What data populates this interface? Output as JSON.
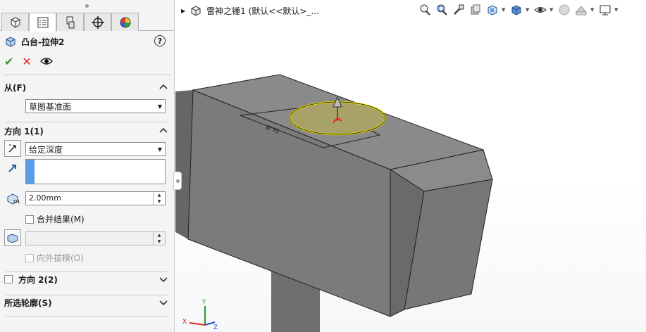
{
  "property_manager": {
    "tabs": [
      {
        "name": "feature-manager"
      },
      {
        "name": "property-manager"
      },
      {
        "name": "configuration-manager"
      },
      {
        "name": "dimxpert-manager"
      },
      {
        "name": "display-manager"
      }
    ],
    "feature_title": "凸台-拉伸2",
    "help_label": "?",
    "from_section": {
      "title": "从(F)",
      "value": "草图基准面"
    },
    "direction1": {
      "title": "方向 1(1)",
      "end_condition": "给定深度",
      "depth": "2.00mm",
      "merge_label": "合并结果(M)",
      "draft_label": "向外拔模(O)"
    },
    "direction2": {
      "title": "方向 2(2)"
    },
    "contours": {
      "title": "所选轮廓(S)"
    }
  },
  "viewport": {
    "tree_title": "雷神之锤1  (默认<<默认>_...",
    "model_color": "#7d7d7d",
    "accent": "#5b9ce6",
    "highlight": "#e8e000",
    "triad": {
      "x": "X",
      "y": "Y",
      "z": "Z"
    }
  }
}
